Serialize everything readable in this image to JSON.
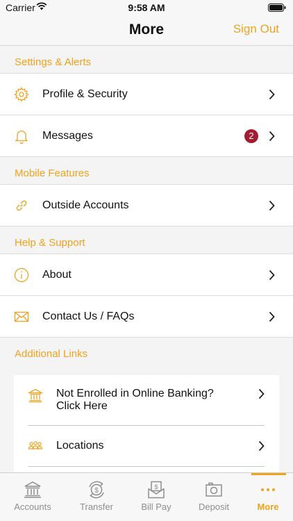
{
  "status_bar": {
    "carrier": "Carrier",
    "time": "9:58 AM"
  },
  "header": {
    "title": "More",
    "sign_out": "Sign Out"
  },
  "sections": {
    "settings": {
      "title": "Settings & Alerts",
      "items": [
        {
          "label": "Profile & Security",
          "icon": "gear-icon"
        },
        {
          "label": "Messages",
          "icon": "bell-icon",
          "badge": "2"
        }
      ]
    },
    "mobile": {
      "title": "Mobile Features",
      "items": [
        {
          "label": "Outside Accounts",
          "icon": "link-icon"
        }
      ]
    },
    "help": {
      "title": "Help & Support",
      "items": [
        {
          "label": "About",
          "icon": "info-icon"
        },
        {
          "label": "Contact Us / FAQs",
          "icon": "envelope-icon"
        }
      ]
    },
    "links": {
      "title": "Additional Links",
      "items": [
        {
          "label": "Not Enrolled in Online Banking? Click Here",
          "icon": "bank-icon"
        },
        {
          "label": "Locations",
          "icon": "people-icon"
        }
      ]
    }
  },
  "tabs": [
    {
      "label": "Accounts",
      "icon": "bank-icon"
    },
    {
      "label": "Transfer",
      "icon": "transfer-icon"
    },
    {
      "label": "Bill Pay",
      "icon": "bill-icon"
    },
    {
      "label": "Deposit",
      "icon": "camera-icon"
    },
    {
      "label": "More",
      "icon": "more-icon",
      "active": true
    }
  ],
  "colors": {
    "accent": "#f1a21f",
    "badge": "#a31c32",
    "tab_inactive": "#8e8e8e"
  }
}
